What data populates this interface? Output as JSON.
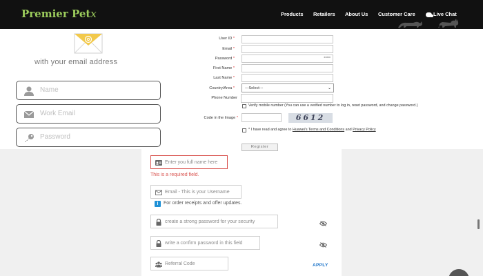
{
  "header": {
    "logo_main": "Premier Pet",
    "logo_tail": "x",
    "nav": [
      "Products",
      "Retailers",
      "About Us",
      "Customer Care"
    ],
    "live_chat": "Live Chat"
  },
  "signup_intro": {
    "tagline": "with your email address",
    "fields": [
      {
        "placeholder": "Name",
        "icon": "person-icon"
      },
      {
        "placeholder": "Work Email",
        "icon": "envelope-icon"
      },
      {
        "placeholder": "Password",
        "icon": "key-icon"
      }
    ]
  },
  "register": {
    "user_id": "User ID",
    "email": "Email",
    "password": "Password",
    "password_mask": "*****",
    "first_name": "First Name",
    "last_name": "Last Name",
    "country": "Country/Area",
    "country_value": "---Select---",
    "phone": "Phone Number",
    "verify_text": "Verify mobile number (You can use a verified number to log in, reset password, and change password.)",
    "code_label": "Code in the Image",
    "captcha_text": "6612",
    "terms_prefix": "* I have read and agree to ",
    "terms_link": "Huawei's Terms and Conditions",
    "terms_and": " and ",
    "privacy_link": "Privacy Policy",
    "register_button": "Register",
    "required_mark": "*"
  },
  "account_form": {
    "full_name_placeholder": "Enter you full name here",
    "error": "This is a required field.",
    "email_placeholder": "Email - This is your Username",
    "info": "For order receipts and offer updates.",
    "password_placeholder": "create a strong password for your security",
    "confirm_placeholder": "write a confirm password in this field",
    "referral_placeholder": "Referral Code",
    "apply": "APPLY"
  },
  "colors": {
    "header_bg": "#111111",
    "logo": "#9ccc5c",
    "error": "#d9534f",
    "link": "#1a73c9",
    "info": "#1e90d6"
  }
}
